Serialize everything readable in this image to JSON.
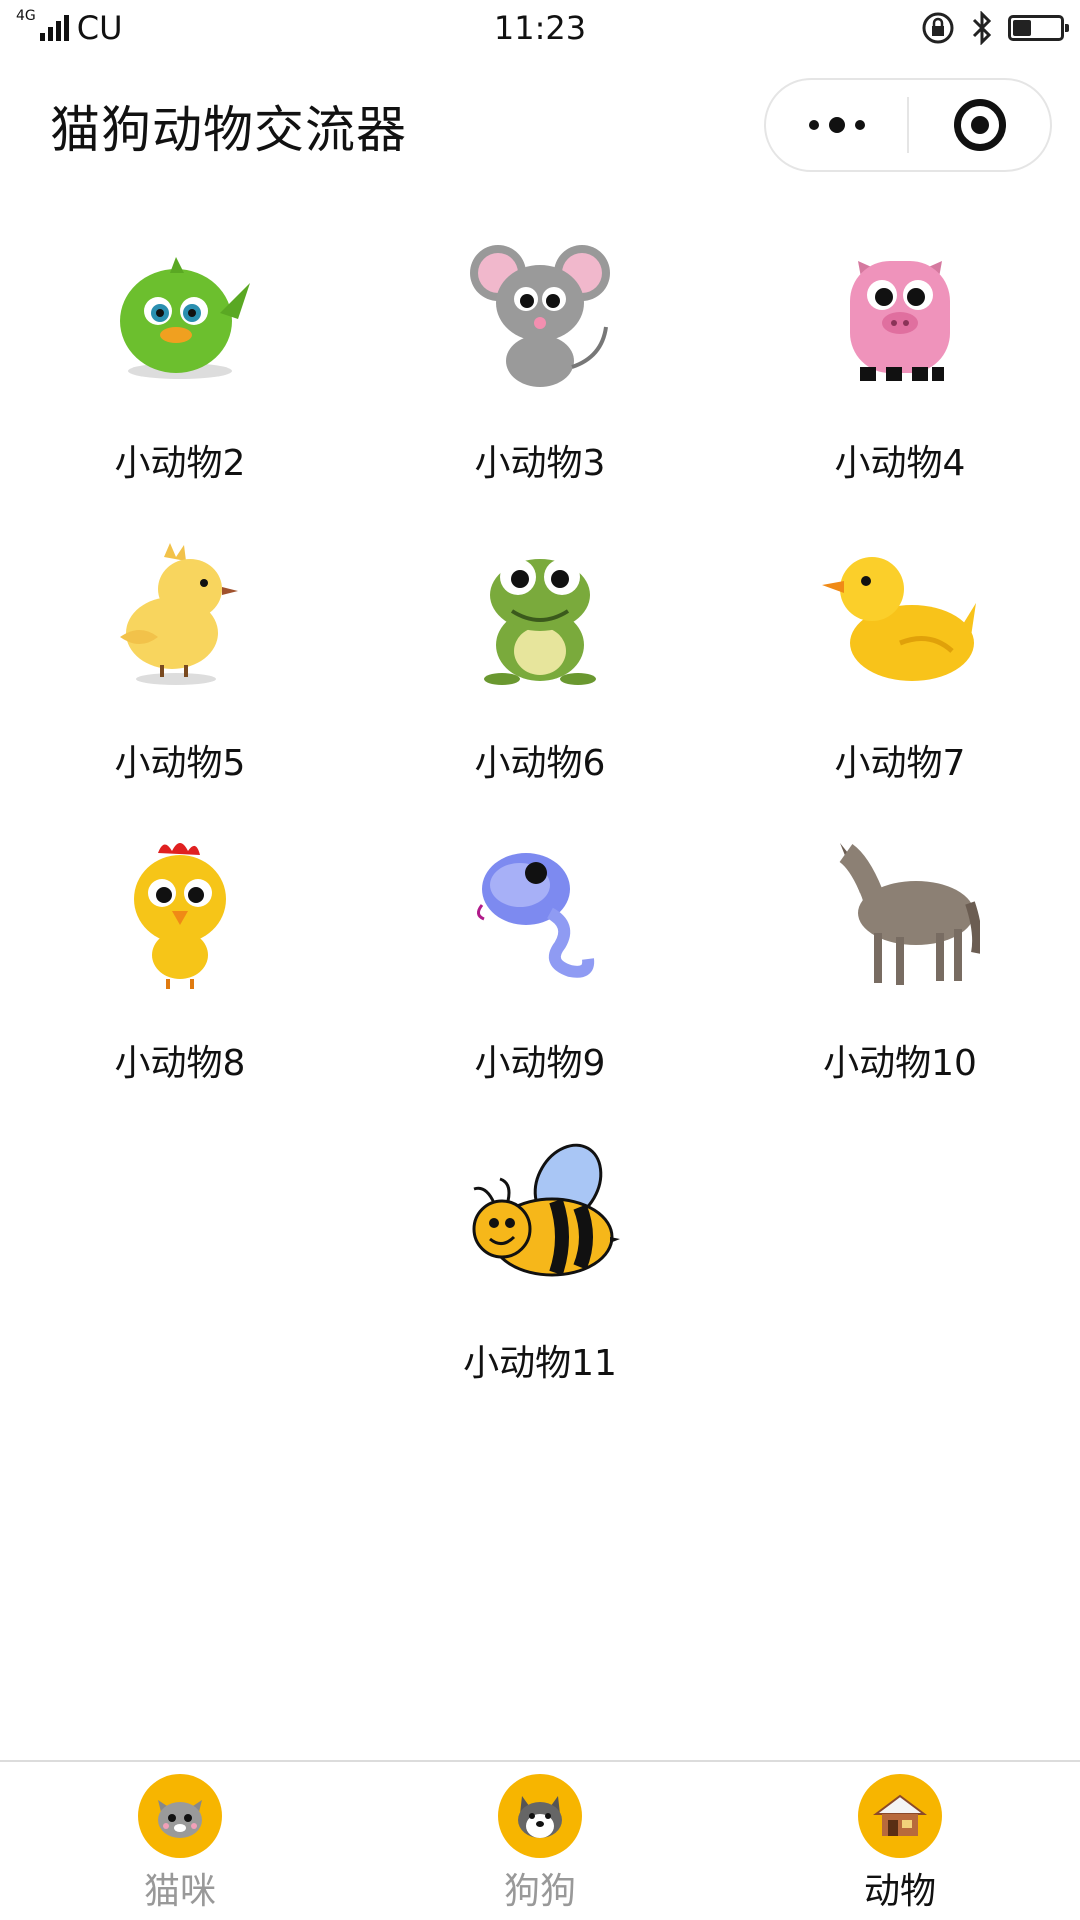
{
  "status": {
    "network": "4G",
    "carrier": "CU",
    "time": "11:23"
  },
  "header": {
    "title": "猫狗动物交流器"
  },
  "animals": [
    {
      "label": "小动物2",
      "icon": "green-bird-icon"
    },
    {
      "label": "小动物3",
      "icon": "mouse-icon"
    },
    {
      "label": "小动物4",
      "icon": "pig-icon"
    },
    {
      "label": "小动物5",
      "icon": "chick-icon"
    },
    {
      "label": "小动物6",
      "icon": "frog-icon"
    },
    {
      "label": "小动物7",
      "icon": "duck-icon"
    },
    {
      "label": "小动物8",
      "icon": "chicken-icon"
    },
    {
      "label": "小动物9",
      "icon": "snake-icon"
    },
    {
      "label": "小动物10",
      "icon": "wolf-icon"
    },
    {
      "label": "小动物11",
      "icon": "bee-icon"
    }
  ],
  "tabs": [
    {
      "label": "猫咪",
      "icon": "cat-icon",
      "active": false
    },
    {
      "label": "狗狗",
      "icon": "dog-icon",
      "active": false
    },
    {
      "label": "动物",
      "icon": "house-icon",
      "active": true
    }
  ],
  "colors": {
    "tab_icon_bg": "#f7b500",
    "tab_inactive": "#999999",
    "tab_active": "#111111"
  }
}
